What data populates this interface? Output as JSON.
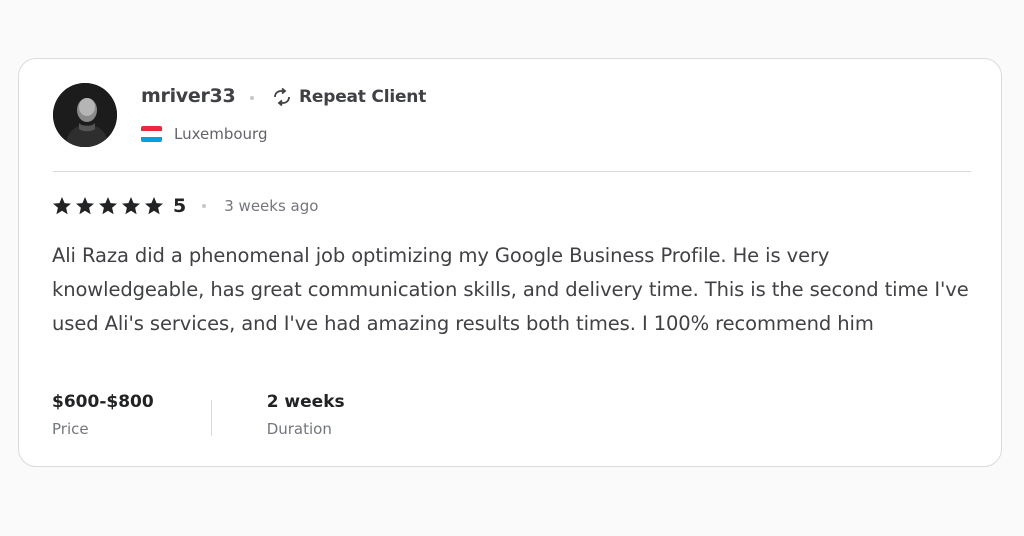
{
  "reviewer": {
    "username": "mriver33",
    "badge": "Repeat Client",
    "country": "Luxembourg",
    "avatar_icon": "user-avatar",
    "badge_icon": "repeat-icon",
    "flag_colors": [
      "#ed2939",
      "#ffffff",
      "#00a1de"
    ]
  },
  "rating": {
    "stars": 5,
    "score": "5",
    "time_ago": "3 weeks ago",
    "star_icon": "star-icon"
  },
  "review_text": "Ali Raza did a phenomenal job optimizing my Google Business Profile. He is very knowledgeable, has great communication skills, and delivery time. This is the second time I've used Ali's services, and I've had amazing results both times. I 100% recommend him",
  "details": {
    "price_value": "$600-$800",
    "price_label": "Price",
    "duration_value": "2 weeks",
    "duration_label": "Duration"
  },
  "colors": {
    "background": "#fafafa",
    "card": "#ffffff",
    "border": "#dadbdd",
    "text_dark": "#222325",
    "text_muted": "#74767e"
  }
}
